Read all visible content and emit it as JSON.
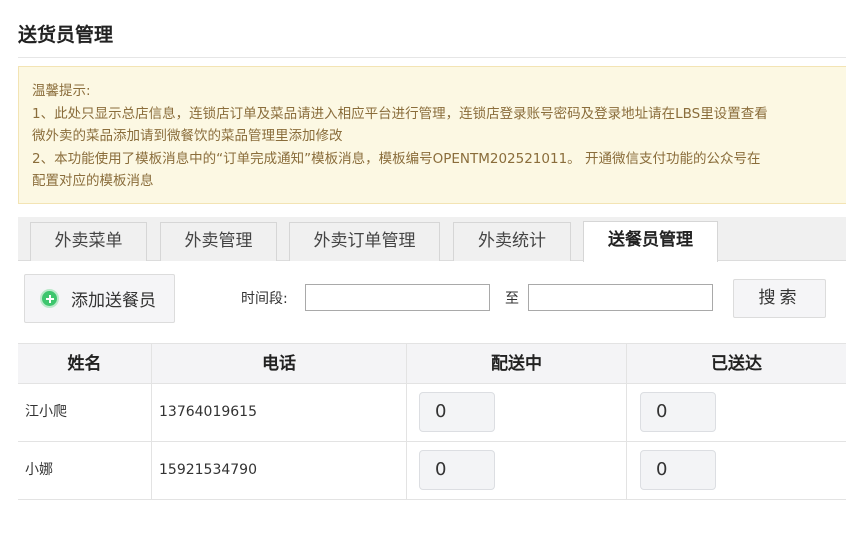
{
  "page": {
    "title": "送货员管理"
  },
  "notice": {
    "lines": [
      "温馨提示:",
      "1、此处只显示总店信息，连锁店订单及菜品请进入相应平台进行管理，连锁店登录账号密码及登录地址请在LBS里设置查看",
      "微外卖的菜品添加请到微餐饮的菜品管理里添加修改",
      "2、本功能使用了模板消息中的“订单完成通知”模板消息，模板编号OPENTM202521011。 开通微信支付功能的公众号在",
      "配置对应的模板消息"
    ]
  },
  "tabs": [
    {
      "label": "外卖菜单"
    },
    {
      "label": "外卖管理"
    },
    {
      "label": "外卖订单管理"
    },
    {
      "label": "外卖统计"
    },
    {
      "label": "送餐员管理",
      "active": true
    }
  ],
  "toolbar": {
    "add_label": "添加送餐员",
    "time_label": "时间段:",
    "start_value": "",
    "to_label": "至",
    "end_value": "",
    "search_label": "搜索"
  },
  "table": {
    "headers": [
      "姓名",
      "电话",
      "配送中",
      "已送达"
    ],
    "rows": [
      {
        "name": "江小爬",
        "phone": "13764019615",
        "delivering": "0",
        "delivered": "0"
      },
      {
        "name": "小娜",
        "phone": "15921534790",
        "delivering": "0",
        "delivered": "0"
      }
    ]
  },
  "colors": {
    "accent": "#3ec66e",
    "notice_bg": "#fcf8e3",
    "notice_text": "#8a6d3b"
  },
  "icons": {
    "add": "plus-circle-icon"
  }
}
